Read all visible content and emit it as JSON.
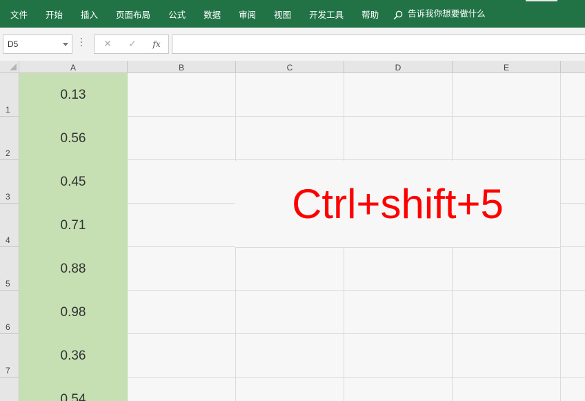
{
  "menu": {
    "items": [
      "文件",
      "开始",
      "插入",
      "页面布局",
      "公式",
      "数据",
      "审阅",
      "视图",
      "开发工具",
      "帮助"
    ],
    "tell_me": "告诉我你想要做什么"
  },
  "formula_bar": {
    "name_box": "D5",
    "cancel_symbol": "✕",
    "enter_symbol": "✓",
    "fx_symbol": "fx",
    "formula": ""
  },
  "sheet": {
    "columns": [
      "A",
      "B",
      "C",
      "D",
      "E"
    ],
    "rows": [
      "1",
      "2",
      "3",
      "4",
      "5",
      "6",
      "7"
    ],
    "column_a_values": [
      "0.13",
      "0.56",
      "0.45",
      "0.71",
      "0.88",
      "0.98",
      "0.36",
      "0.54"
    ],
    "merged_text": "Ctrl+shift+5"
  },
  "colors": {
    "ribbon": "#217346",
    "highlight_fill": "#c6e0b4",
    "annotation_text": "#ff0000"
  }
}
